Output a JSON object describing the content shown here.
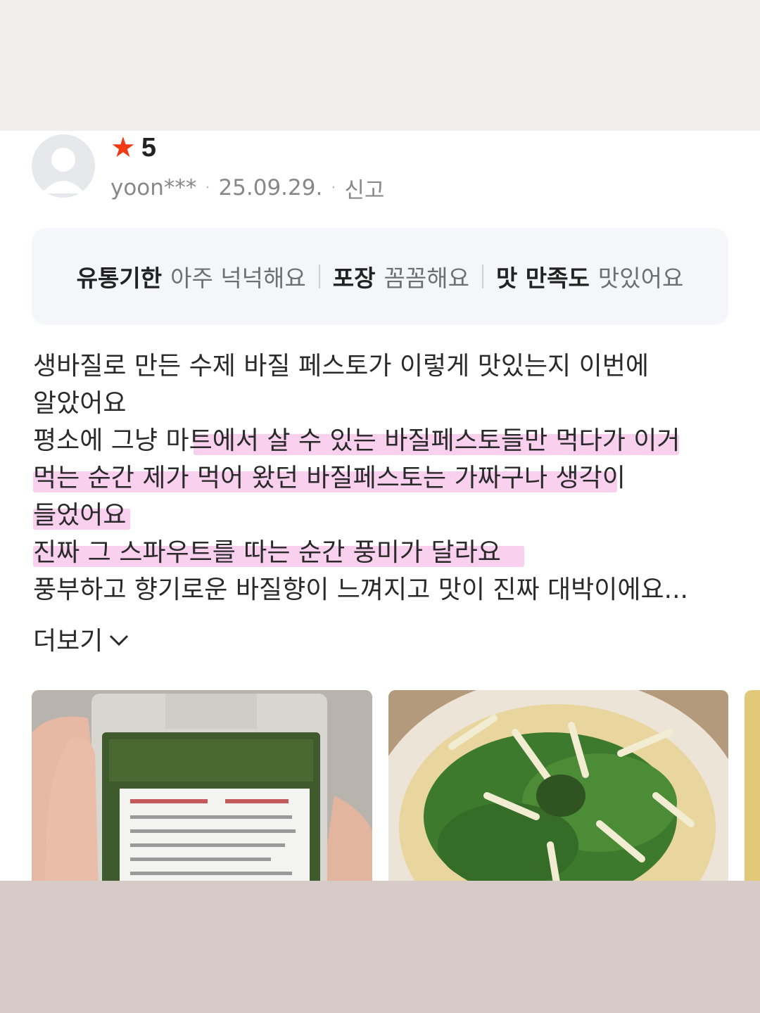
{
  "review": {
    "rating": "5",
    "user": "yoon***",
    "date": "25.09.29.",
    "report_label": "신고",
    "options": [
      {
        "key": "유통기한",
        "value": "아주 넉넉해요"
      },
      {
        "key": "포장",
        "value": "꼼꼼해요"
      },
      {
        "key": "맛 만족도",
        "value": "맛있어요"
      }
    ],
    "lines": [
      "생바질로 만든 수제 바질 페스토가 이렇게 맛있는지 이번에",
      "알았어요",
      "평소에 그냥 마트에서 살 수 있는 바질페스토들만 먹다가 이거",
      "먹는 순간 제가 먹어 왔던 바질페스토는 가짜구나 생각이",
      "들었어요",
      "진짜 그 스파우트를 따는 순간 풍미가 달라요",
      "풍부하고 향기로운 바질향이 느껴지고 맛이 진짜 대박이에요..."
    ],
    "more_label": "더보기",
    "icons": {
      "star": "star-icon",
      "avatar": "default-avatar-icon",
      "more": "chevron-down-icon"
    },
    "colors": {
      "star": "#f23a12",
      "highlight": "#f8c8ea"
    }
  }
}
